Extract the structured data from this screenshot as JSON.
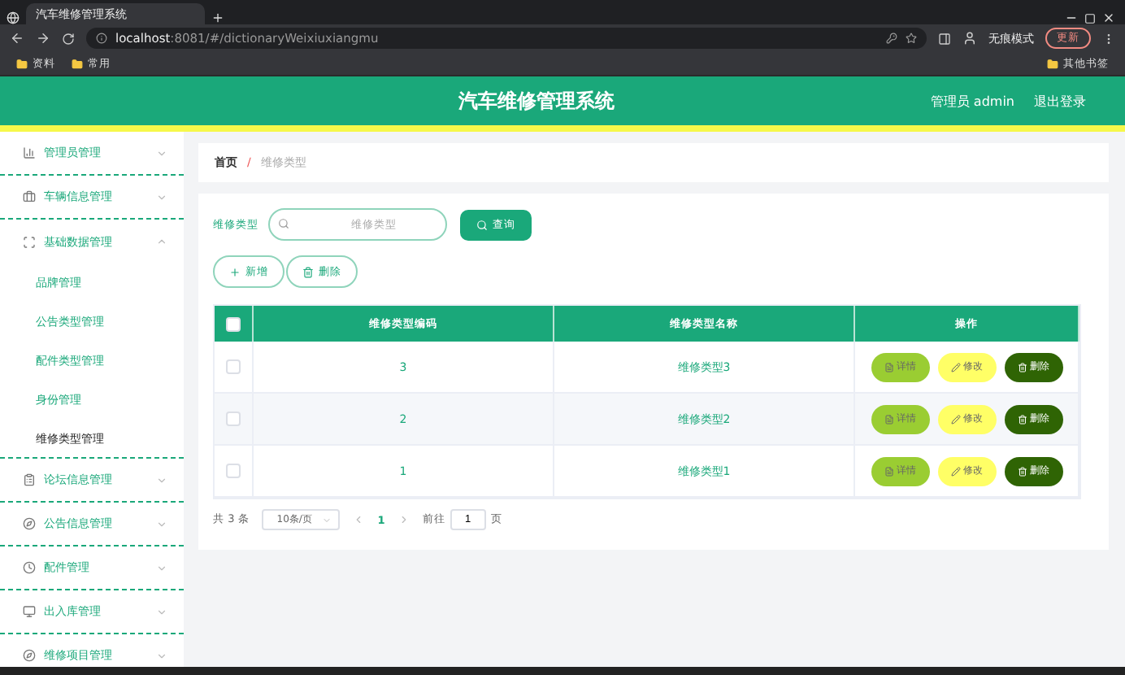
{
  "browser": {
    "tabs": [
      {
        "title": "汽车维修管理系统",
        "selected": true
      }
    ],
    "address_host": "localhost",
    "address_path": ":8081/#/dictionaryWeixiuxiangmu",
    "profile": "无痕模式",
    "update": "更新",
    "bookmarks": [
      "资料",
      "常用"
    ],
    "other_bookmarks": "其他书签"
  },
  "header": {
    "title": "汽车维修管理系统",
    "user": "管理员 admin",
    "logout": "退出登录"
  },
  "sidebar": {
    "items": [
      {
        "label": "管理员管理",
        "expanded": false
      },
      {
        "label": "车辆信息管理",
        "expanded": false
      },
      {
        "label": "基础数据管理",
        "expanded": true,
        "children": [
          {
            "label": "品牌管理",
            "selected": false
          },
          {
            "label": "公告类型管理",
            "selected": false
          },
          {
            "label": "配件类型管理",
            "selected": false
          },
          {
            "label": "身份管理",
            "selected": false
          },
          {
            "label": "维修类型管理",
            "selected": true
          }
        ]
      },
      {
        "label": "论坛信息管理",
        "expanded": false
      },
      {
        "label": "公告信息管理",
        "expanded": false
      },
      {
        "label": "配件管理",
        "expanded": false
      },
      {
        "label": "出入库管理",
        "expanded": false
      },
      {
        "label": "维修项目管理",
        "expanded": false
      }
    ]
  },
  "breadcrumb": [
    "首页",
    "/",
    "维修类型"
  ],
  "search": {
    "label": "维修类型",
    "placeholder": "维修类型",
    "button": "查询"
  },
  "actions": [
    {
      "kind": "add",
      "label": "新增"
    },
    {
      "kind": "delete",
      "label": "删除"
    }
  ],
  "table": {
    "columns": [
      "维修类型编码",
      "维修类型名称",
      "操作"
    ],
    "rows": [
      {
        "checked": false,
        "code": "3",
        "name": "维修类型3",
        "actions": [
          {
            "kind": "detail",
            "label": "详情"
          },
          {
            "kind": "edit",
            "label": "修改"
          },
          {
            "kind": "delete",
            "label": "删除"
          }
        ]
      },
      {
        "checked": false,
        "code": "2",
        "name": "维修类型2",
        "actions": [
          {
            "kind": "detail",
            "label": "详情"
          },
          {
            "kind": "edit",
            "label": "修改"
          },
          {
            "kind": "delete",
            "label": "删除"
          }
        ]
      },
      {
        "checked": false,
        "code": "1",
        "name": "维修类型1",
        "actions": [
          {
            "kind": "detail",
            "label": "详情"
          },
          {
            "kind": "edit",
            "label": "修改"
          },
          {
            "kind": "delete",
            "label": "删除"
          }
        ]
      }
    ],
    "select_all_checked": false
  },
  "pagination": {
    "total": "共 3 条",
    "page_size": "10条/页",
    "pages": [
      {
        "label": "1",
        "selected": true
      }
    ],
    "goto": "前往",
    "goto_value": "1",
    "suffix": "页"
  }
}
